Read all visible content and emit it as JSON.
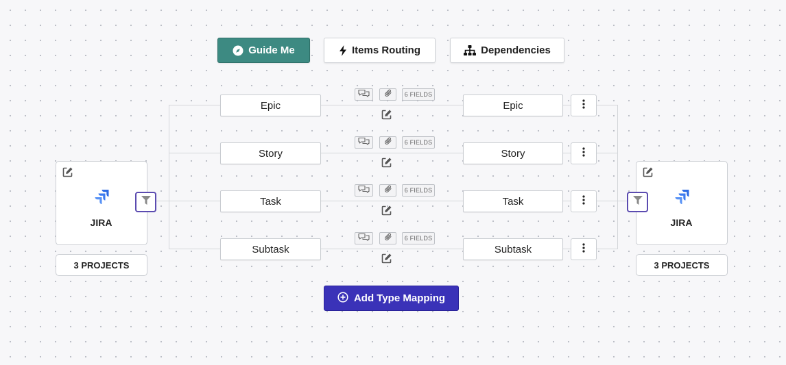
{
  "toolbar": {
    "guide_label": "Guide Me",
    "routing_label": "Items Routing",
    "dependencies_label": "Dependencies"
  },
  "left_system": {
    "name": "JIRA",
    "projects_label": "3 PROJECTS"
  },
  "right_system": {
    "name": "JIRA",
    "projects_label": "3 PROJECTS"
  },
  "mappings": [
    {
      "left": "Epic",
      "right": "Epic",
      "fields": "6 FIELDS"
    },
    {
      "left": "Story",
      "right": "Story",
      "fields": "6 FIELDS"
    },
    {
      "left": "Task",
      "right": "Task",
      "fields": "6 FIELDS"
    },
    {
      "left": "Subtask",
      "right": "Subtask",
      "fields": "6 FIELDS"
    }
  ],
  "add_mapping_label": "Add Type Mapping",
  "colors": {
    "guide_bg": "#3d8a82",
    "add_bg": "#3a32b8",
    "filter_border": "#5b4bb0",
    "jira_blue": "#2d6ae3"
  }
}
